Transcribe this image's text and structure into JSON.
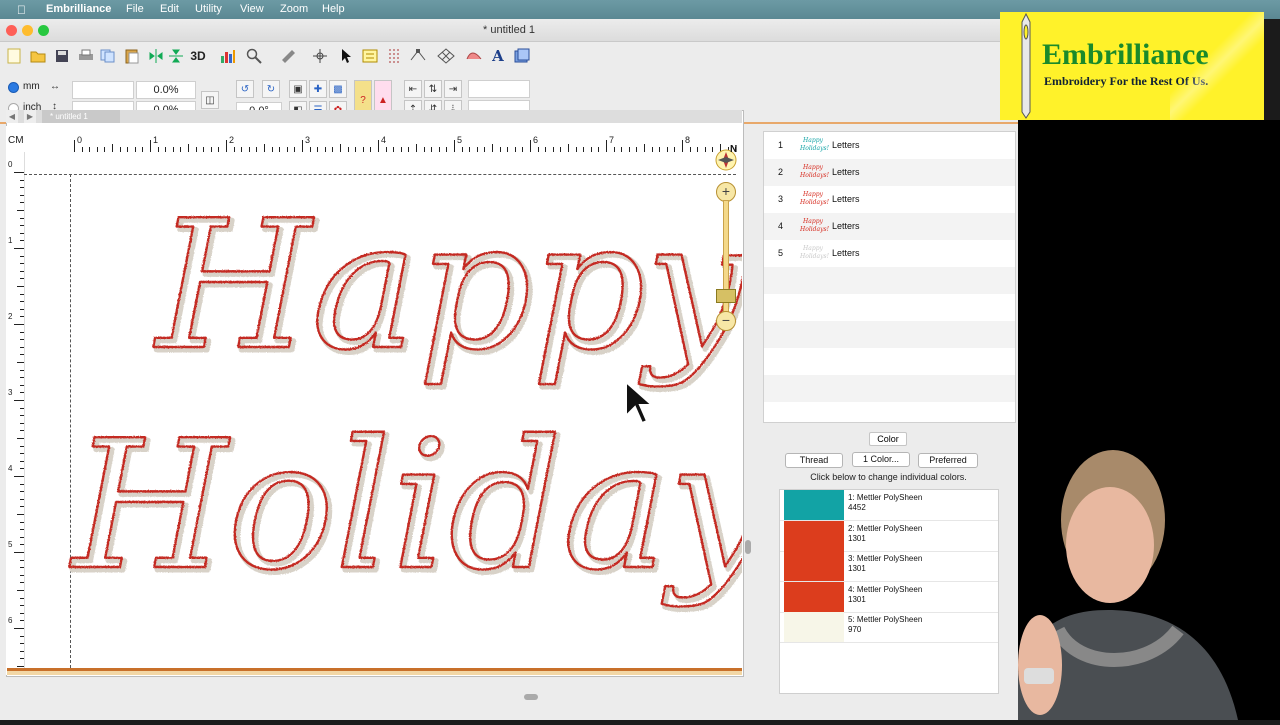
{
  "menubar": {
    "app_name": "Embrilliance",
    "items": [
      "File",
      "Edit",
      "Utility",
      "View",
      "Zoom",
      "Help"
    ]
  },
  "window": {
    "title": "* untitled 1"
  },
  "toolbar2": {
    "unit_mm": "mm",
    "unit_inch": "inch",
    "width_pct": "0.0%",
    "height_pct": "0.0%",
    "rotation": "0.0°"
  },
  "canvas": {
    "tab_label": "* untitled 1",
    "ruler_unit": "CM",
    "h_ruler_labels": [
      "0",
      "1",
      "2",
      "3",
      "4",
      "5",
      "6",
      "7",
      "8"
    ],
    "v_ruler_labels": [
      "0",
      "1",
      "2",
      "3",
      "4",
      "5",
      "6"
    ],
    "compass_label": "N",
    "design_text_line1": "Happy",
    "design_text_line2": "Holidays!"
  },
  "layers": [
    {
      "num": "1",
      "label": "Letters",
      "thumb": "Happy Holidays!",
      "color": "#12a3a5"
    },
    {
      "num": "2",
      "label": "Letters",
      "thumb": "Happy Holidays!",
      "color": "#d6281c"
    },
    {
      "num": "3",
      "label": "Letters",
      "thumb": "Happy Holidays!",
      "color": "#d6281c"
    },
    {
      "num": "4",
      "label": "Letters",
      "thumb": "Happy Holidays!",
      "color": "#d6281c"
    },
    {
      "num": "5",
      "label": "Letters",
      "thumb": "Happy Holidays!",
      "color": "#c8c8c8"
    }
  ],
  "color_panel": {
    "header": "Color",
    "thread_btn": "Thread",
    "one_color_btn": "1 Color...",
    "preferred_btn": "Preferred",
    "hint": "Click below to change individual colors.",
    "colors": [
      {
        "line1": "1: Mettler PolySheen",
        "line2": "4452",
        "hex": "#12a3a5"
      },
      {
        "line1": "2: Mettler PolySheen",
        "line2": "1301",
        "hex": "#dc3d1d"
      },
      {
        "line1": "3: Mettler PolySheen",
        "line2": "1301",
        "hex": "#dc3d1d"
      },
      {
        "line1": "4: Mettler PolySheen",
        "line2": "1301",
        "hex": "#dc3d1d"
      },
      {
        "line1": "5: Mettler PolySheen",
        "line2": "970",
        "hex": "#f7f6e8"
      }
    ]
  },
  "logo": {
    "brand": "Embrilliance",
    "tagline": "Embroidery For the Rest Of Us."
  }
}
